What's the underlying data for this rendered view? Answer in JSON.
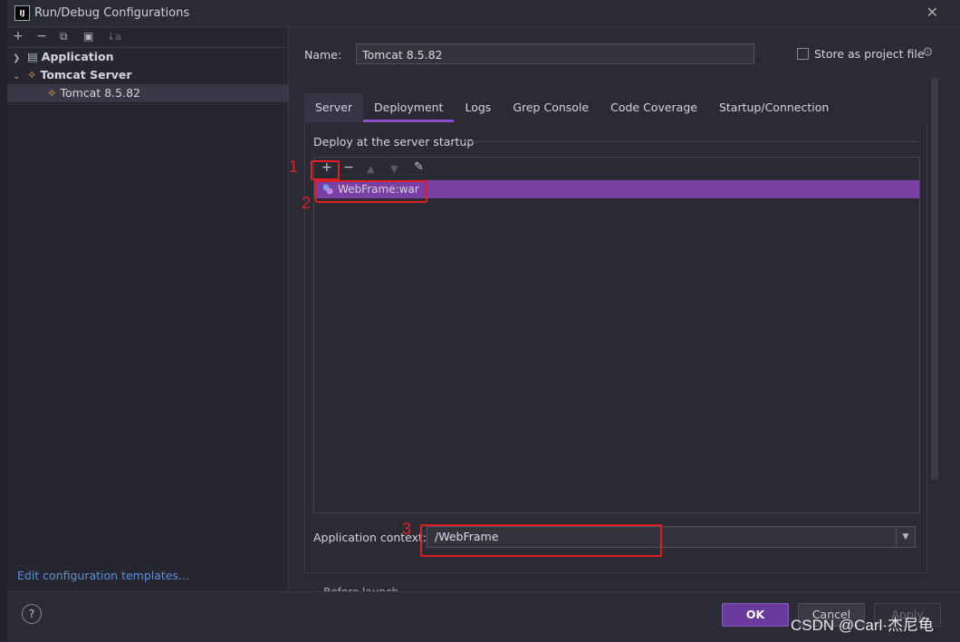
{
  "window": {
    "title": "Run/Debug Configurations",
    "app_icon": "IJ"
  },
  "left_toolbar": {
    "add": "+",
    "remove": "−",
    "copy": "⧉",
    "folder": "▣",
    "sort": "↓a"
  },
  "tree": {
    "application": "Application",
    "tomcat_server": "Tomcat Server",
    "tomcat_config": "Tomcat 8.5.82"
  },
  "edit_templates": "Edit configuration templates...",
  "form": {
    "name_label": "Name:",
    "name_value": "Tomcat 8.5.82",
    "store_label": "Store as project file"
  },
  "tabs": [
    "Server",
    "Deployment",
    "Logs",
    "Grep Console",
    "Code Coverage",
    "Startup/Connection"
  ],
  "deployment": {
    "section_label": "Deploy at the server startup",
    "artifacts": [
      "WebFrame:war"
    ],
    "context_label": "Application context:",
    "context_value": "/WebFrame",
    "below_cut": "Before launch"
  },
  "buttons": {
    "ok": "OK",
    "cancel": "Cancel",
    "apply": "Apply",
    "help": "?"
  },
  "annotations": [
    "1",
    "2",
    "3"
  ],
  "watermark": "CSDN @Carl·杰尼龟",
  "colors": {
    "accent": "#8e4ec6",
    "selected_row": "#7a3fa3",
    "annotation": "#e02020"
  }
}
